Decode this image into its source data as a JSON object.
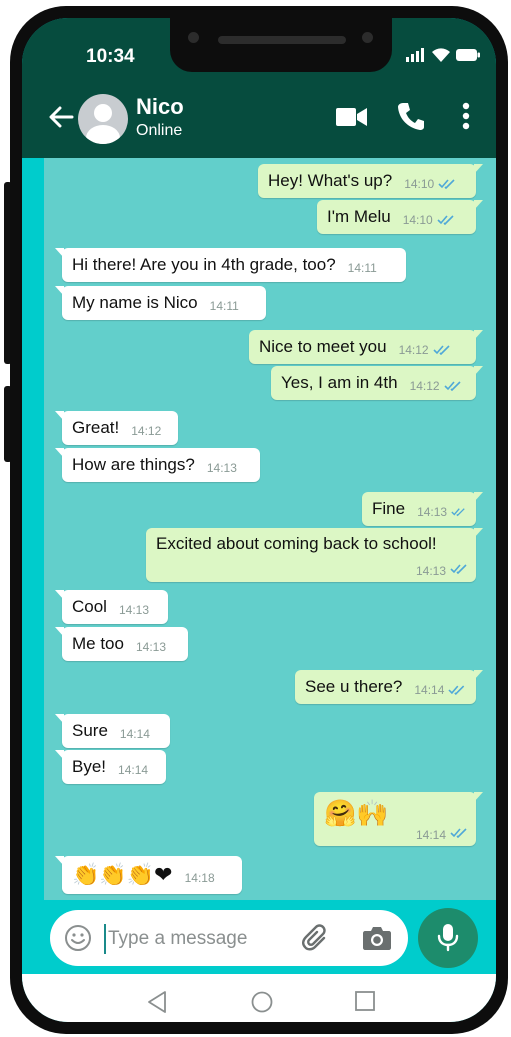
{
  "status_bar": {
    "time": "10:34"
  },
  "header": {
    "contact_name": "Nico",
    "contact_status": "Online"
  },
  "messages": [
    {
      "dir": "out",
      "text": "Hey! What's up?",
      "time": "14:10"
    },
    {
      "dir": "out",
      "text": "I'm Melu",
      "time": "14:10"
    },
    {
      "dir": "in",
      "text": "Hi there! Are you in 4th grade, too?",
      "time": "14:11"
    },
    {
      "dir": "in",
      "text": "My name is Nico",
      "time": "14:11"
    },
    {
      "dir": "out",
      "text": "Nice to meet you",
      "time": "14:12"
    },
    {
      "dir": "out",
      "text": "Yes, I am in 4th",
      "time": "14:12"
    },
    {
      "dir": "in",
      "text": "Great!",
      "time": "14:12"
    },
    {
      "dir": "in",
      "text": "How are things?",
      "time": "14:13"
    },
    {
      "dir": "out",
      "text": "Fine",
      "time": "14:13"
    },
    {
      "dir": "out",
      "text": "Excited about coming back to school!",
      "time": "14:13"
    },
    {
      "dir": "in",
      "text": "Cool",
      "time": "14:13"
    },
    {
      "dir": "in",
      "text": "Me too",
      "time": "14:13"
    },
    {
      "dir": "out",
      "text": "See u there?",
      "time": "14:14"
    },
    {
      "dir": "in",
      "text": "Sure",
      "time": "14:14"
    },
    {
      "dir": "in",
      "text": "Bye!",
      "time": "14:14"
    },
    {
      "dir": "out",
      "text": "🤗🙌",
      "time": "14:14"
    },
    {
      "dir": "in",
      "text": "👏👏👏❤",
      "time": "14:18"
    }
  ],
  "composer": {
    "placeholder": "Type a message"
  },
  "colors": {
    "header_bg": "#064c3e",
    "chat_bg": "#62cfcb",
    "outgoing_bubble": "#dcf7c5",
    "incoming_bubble": "#ffffff",
    "read_ticks": "#4fa8d8",
    "mic_button": "#1d8c6c"
  },
  "icons": [
    "back-arrow-icon",
    "avatar-icon",
    "video-call-icon",
    "phone-icon",
    "more-vert-icon",
    "emoji-icon",
    "attach-icon",
    "camera-icon",
    "mic-icon",
    "nav-back-icon",
    "nav-home-icon",
    "nav-recents-icon",
    "signal-icon",
    "wifi-icon",
    "battery-icon",
    "read-ticks-icon"
  ]
}
